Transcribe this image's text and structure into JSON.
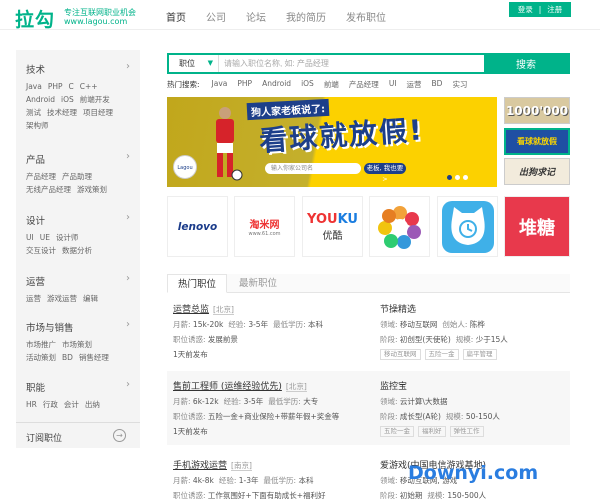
{
  "header": {
    "logo": "拉勾",
    "slogan_line1": "专注互联网职业机会",
    "slogan_line2": "www.lagou.com",
    "nav": [
      "首页",
      "公司",
      "论坛",
      "我的简历",
      "发布职位"
    ],
    "login": "登录",
    "separator": "|",
    "register": "注册"
  },
  "sidebar": {
    "categories": [
      {
        "title": "技术",
        "tags": [
          "Java",
          "PHP",
          "C",
          "C++",
          "Android",
          "iOS",
          "前端开发",
          "测试",
          "技术经理",
          "项目经理",
          "架构师"
        ]
      },
      {
        "title": "产品",
        "tags": [
          "产品经理",
          "产品助理",
          "无线产品经理",
          "游戏策划"
        ]
      },
      {
        "title": "设计",
        "tags": [
          "UI",
          "UE",
          "设计师",
          "交互设计",
          "数据分析"
        ]
      },
      {
        "title": "运营",
        "tags": [
          "运营",
          "游戏运营",
          "编辑"
        ]
      },
      {
        "title": "市场与销售",
        "tags": [
          "市场推广",
          "市场策划",
          "活动策划",
          "BD",
          "销售经理"
        ]
      },
      {
        "title": "职能",
        "tags": [
          "HR",
          "行政",
          "会计",
          "出纳"
        ]
      }
    ],
    "subscribe": "订阅职位"
  },
  "search": {
    "type": "职位",
    "placeholder": "请输入职位名称, 如: 产品经理",
    "button": "搜索",
    "hot_label": "热门搜索:",
    "hot": [
      "Java",
      "PHP",
      "Android",
      "iOS",
      "前端",
      "产品经理",
      "UI",
      "运营",
      "BD",
      "实习"
    ]
  },
  "banner": {
    "top_text": "狗人家老板说了:",
    "main_text": "看球就放假!",
    "input_placeholder": "输入你家公司名",
    "button": "老板, 我也要 >",
    "badge": "Lagou"
  },
  "thumbs": [
    "1000'000",
    "看球就放假",
    "出狗求记"
  ],
  "logos": {
    "lenovo": "lenovo",
    "taomi": "淘米网",
    "taomi_sub": "www.61.com",
    "youku_a": "YOU",
    "youku_b": "KU",
    "youku_cn": "优酷",
    "duitang": "堆糖"
  },
  "tabs": [
    "热门职位",
    "最新职位"
  ],
  "jobs": [
    {
      "title": "运营总监",
      "loc": "[北京]",
      "l1": [
        [
          "月薪: ",
          "15k-20k"
        ],
        [
          "经验: ",
          "3-5年"
        ],
        [
          "最低学历: ",
          "本科"
        ]
      ],
      "l2": [
        [
          "职位诱惑: ",
          "发展前景"
        ]
      ],
      "l3": "1天前发布",
      "tags": []
    },
    {
      "title": "节操精选",
      "loc": "",
      "l1": [
        [
          "领域: ",
          "移动互联网"
        ],
        [
          "创始人: ",
          "陈桦"
        ]
      ],
      "l2": [
        [
          "阶段: ",
          "初创型(天使轮)"
        ],
        [
          "规模: ",
          "少于15人"
        ]
      ],
      "l3": "",
      "tags": [
        "移动互联网",
        "五险一金",
        "扁平管理"
      ]
    },
    {
      "title": "售前工程师 (运维经验优先)",
      "loc": "[北京]",
      "l1": [
        [
          "月薪: ",
          "6k-12k"
        ],
        [
          "经验: ",
          "3-5年"
        ],
        [
          "最低学历: ",
          "大专"
        ]
      ],
      "l2": [
        [
          "职位诱惑: ",
          "五险一金+商业保险+带薪年假+奖金等"
        ]
      ],
      "l3": "1天前发布",
      "tags": []
    },
    {
      "title": "监控宝",
      "loc": "",
      "l1": [
        [
          "领域: ",
          "云计算\\大数据"
        ]
      ],
      "l2": [
        [
          "阶段: ",
          "成长型(A轮)"
        ],
        [
          "规模: ",
          "50-150人"
        ]
      ],
      "l3": "",
      "tags": [
        "五险一金",
        "福利好",
        "弹性工作"
      ]
    },
    {
      "title": "手机游戏运营",
      "loc": "[南京]",
      "l1": [
        [
          "月薪: ",
          "4k-8k"
        ],
        [
          "经验: ",
          "1-3年"
        ],
        [
          "最低学历: ",
          "本科"
        ]
      ],
      "l2": [
        [
          "职位诱惑: ",
          "工作氛围好+下面有助成长+福利好"
        ]
      ],
      "l3": "",
      "tags": []
    },
    {
      "title": "爱游戏(中国电信游戏基地)",
      "loc": "",
      "l1": [
        [
          "领域: ",
          "移动互联网, 游戏"
        ]
      ],
      "l2": [
        [
          "阶段: ",
          "初始期"
        ],
        [
          "规模: ",
          "150-500人"
        ]
      ],
      "l3": "",
      "tags": []
    }
  ],
  "watermark": "Downyi.com"
}
